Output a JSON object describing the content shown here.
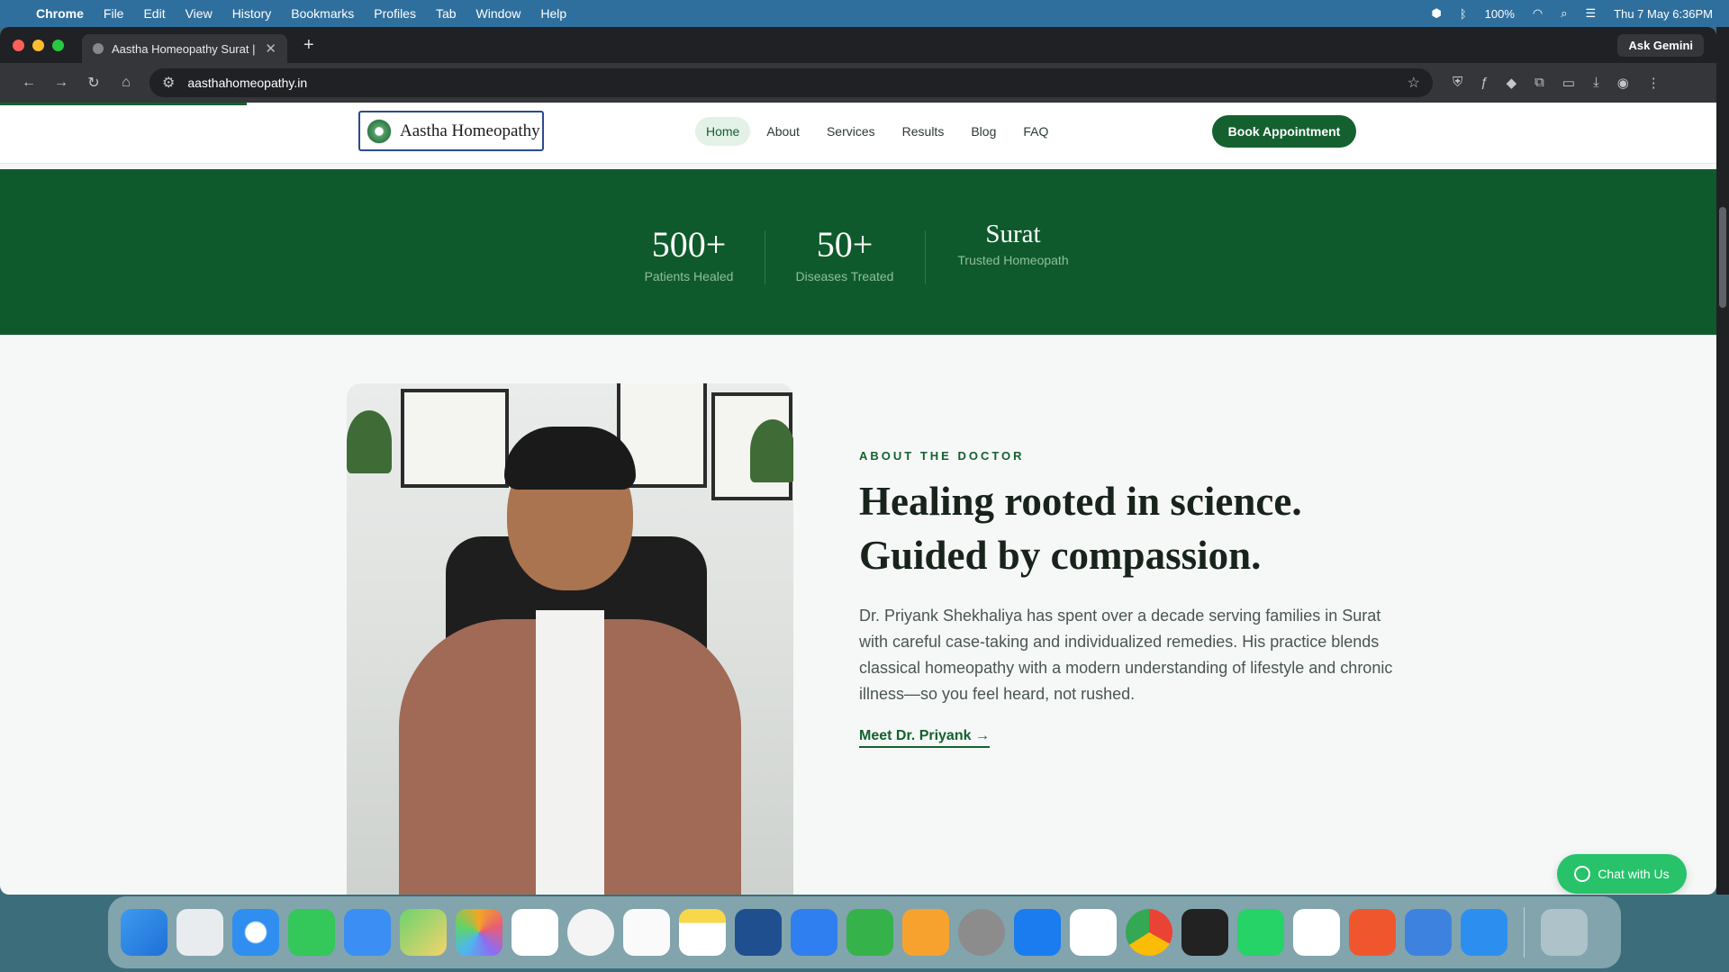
{
  "menubar": {
    "app": "Chrome",
    "items": [
      "File",
      "Edit",
      "View",
      "History",
      "Bookmarks",
      "Profiles",
      "Tab",
      "Window",
      "Help"
    ],
    "battery": "100%",
    "datetime": "Thu 7 May  6:36PM"
  },
  "browser": {
    "tab_title": "Aastha Homeopathy Surat | D",
    "url": "aasthahomeopathy.in",
    "gemini_label": "Ask Gemini"
  },
  "site": {
    "logo_text": "Aastha Homeopathy",
    "nav": [
      "Home",
      "About",
      "Services",
      "Results",
      "Blog",
      "FAQ"
    ],
    "active_nav": "Home",
    "cta": "Book Appointment",
    "stats": [
      {
        "value": "500+",
        "label": "Patients Healed"
      },
      {
        "value": "50+",
        "label": "Diseases Treated"
      },
      {
        "value": "Surat",
        "label": "Trusted Homeopath"
      }
    ],
    "about": {
      "eyebrow": "ABOUT THE DOCTOR",
      "headline_1": "Healing rooted in science.",
      "headline_2": "Guided by compassion.",
      "paragraph": "Dr. Priyank Shekhaliya has spent over a decade serving families in Surat with careful case-taking and individualized remedies. His practice blends classical homeopathy with a modern understanding of lifestyle and chronic illness—so you feel heard, not rushed.",
      "link": "Meet Dr. Priyank →"
    },
    "chat_label": "Chat with Us"
  },
  "colors": {
    "brand_green": "#14612f",
    "stats_bg": "#0f5a2c",
    "chat_green": "#27c26a"
  },
  "dock_apps": [
    "finder-icon",
    "launchpad-icon",
    "safari-icon",
    "messages-icon",
    "mail-icon",
    "maps-icon",
    "photos-icon",
    "calendar-icon",
    "clock-icon",
    "reminders-icon",
    "notes-icon",
    "freeform-icon",
    "keynote-icon",
    "numbers-icon",
    "pages-icon",
    "settings-icon",
    "app-store-icon",
    "tasks-icon",
    "chrome-icon",
    "unity-icon",
    "whatsapp-icon",
    "mongodb-icon",
    "pen-icon",
    "db-icon",
    "window-icon",
    "trash-icon"
  ]
}
